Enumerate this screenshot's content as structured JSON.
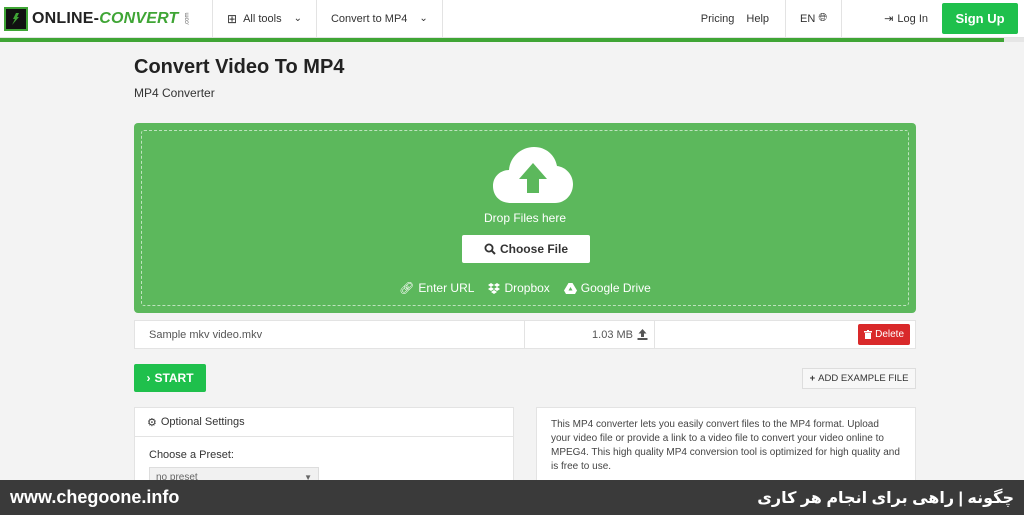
{
  "header": {
    "logo_main": "ONLINE-",
    "logo_accent": "CONVERT",
    "logo_suffix": ".com",
    "all_tools": "All tools",
    "convert_to": "Convert to MP4",
    "pricing": "Pricing",
    "help": "Help",
    "lang": "EN",
    "login": "Log In",
    "signup": "Sign Up"
  },
  "page": {
    "title": "Convert Video To MP4",
    "subtitle": "MP4 Converter"
  },
  "dropzone": {
    "drop_text": "Drop Files here",
    "choose_file": "Choose File",
    "enter_url": "Enter URL",
    "dropbox": "Dropbox",
    "google_drive": "Google Drive"
  },
  "file": {
    "name": "Sample mkv video.mkv",
    "size": "1.03 MB",
    "delete": "Delete"
  },
  "actions": {
    "start": "START",
    "add_example": "ADD EXAMPLE FILE"
  },
  "settings": {
    "title": "Optional Settings",
    "preset_label": "Choose a Preset:",
    "preset_value": "no preset"
  },
  "description": "This MP4 converter lets you easily convert files to the MP4 format. Upload your video file or provide a link to a video file to convert your video online to MPEG4. This high quality MP4 conversion tool is optimized for high quality and is free to use.",
  "watermark": {
    "left": "www.chegoone.info",
    "right": "چگونه | راهی برای انجام هر کاری"
  },
  "colors": {
    "brand_green": "#3fa535",
    "dropzone": "#5cb85c",
    "button_green": "#1fc04c",
    "delete_red": "#d9292a"
  },
  "icons": [
    "grid-icon",
    "chevron-down-icon",
    "globe-icon",
    "login-icon",
    "cloud-upload-icon",
    "search-icon",
    "link-icon",
    "dropbox-icon",
    "google-drive-icon",
    "upload-icon",
    "trash-icon",
    "chevron-right-icon",
    "plus-icon",
    "gear-icon"
  ]
}
